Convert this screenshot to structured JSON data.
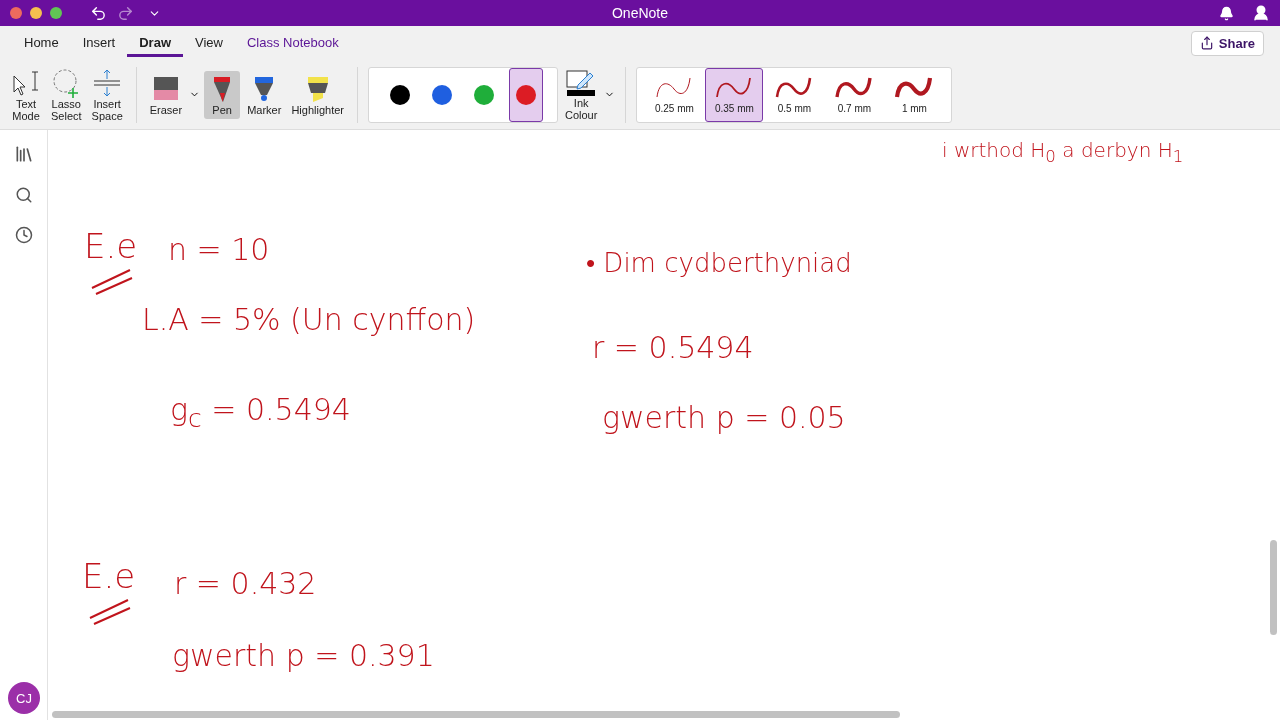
{
  "window": {
    "title": "OneNote"
  },
  "tabs": [
    {
      "label": "Home",
      "selected": false
    },
    {
      "label": "Insert",
      "selected": false
    },
    {
      "label": "Draw",
      "selected": true
    },
    {
      "label": "View",
      "selected": false
    },
    {
      "label": "Class Notebook",
      "selected": false
    }
  ],
  "share_button": "Share",
  "tools": [
    {
      "kind": "text-mode",
      "label": "Text Mode",
      "selected": false
    },
    {
      "kind": "lasso",
      "label": "Lasso Select",
      "selected": false
    },
    {
      "kind": "insert-space",
      "label": "Insert Space",
      "selected": false
    },
    {
      "kind": "eraser",
      "label": "Eraser",
      "selected": false
    },
    {
      "kind": "pen",
      "label": "Pen",
      "selected": true
    },
    {
      "kind": "marker",
      "label": "Marker",
      "selected": false
    },
    {
      "kind": "highlighter",
      "label": "Highlighter",
      "selected": false
    }
  ],
  "colours": [
    {
      "color": "#000000",
      "selected": false
    },
    {
      "color": "#1f5fe0",
      "selected": false
    },
    {
      "color": "#1fae3a",
      "selected": false
    },
    {
      "color": "#dc1c24",
      "selected": true
    }
  ],
  "ink_colour": "Ink Colour",
  "thicknesses": [
    {
      "label": "0.25 mm",
      "selected": false
    },
    {
      "label": "0.35 mm",
      "selected": true
    },
    {
      "label": "0.5 mm",
      "selected": false
    },
    {
      "label": "0.7 mm",
      "selected": false
    },
    {
      "label": "1 mm",
      "selected": false
    }
  ],
  "notes": [
    {
      "kind": "text",
      "text": "i wrthod H$_{0}$ a derbyn H$_{1}$"
    },
    {
      "kind": "heading",
      "text": "E.e"
    },
    {
      "kind": "text",
      "text": "n = 10"
    },
    {
      "kind": "text",
      "text": "L.A = 5% (Un cynffon)"
    },
    {
      "kind": "text",
      "text": "g$_{c}$ = 0.5494"
    },
    {
      "kind": "text",
      "text": "• Dim cydberthyniad"
    },
    {
      "kind": "text",
      "text": "r = 0.5494"
    },
    {
      "kind": "text",
      "text": "gwerth p = 0.05"
    },
    {
      "kind": "heading",
      "text": "E.e"
    },
    {
      "kind": "text",
      "text": "r = 0.432"
    },
    {
      "kind": "text",
      "text": "gwerth p = 0.391"
    }
  ],
  "avatar": "CJ"
}
